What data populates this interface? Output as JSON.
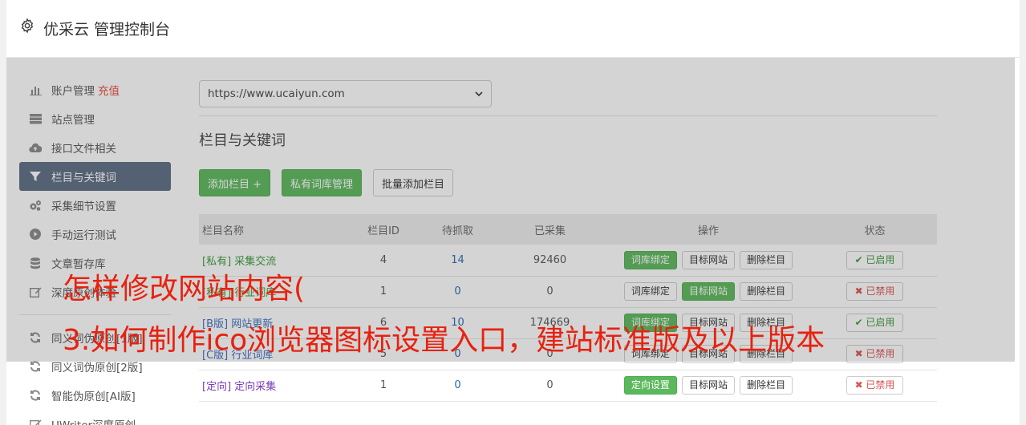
{
  "header": {
    "title": "优采云 管理控制台",
    "icon": "gear-icon"
  },
  "sidebar": {
    "items": [
      {
        "label": "账户管理",
        "extra": "充值",
        "icon": "bar-chart-icon",
        "active": false
      },
      {
        "label": "站点管理",
        "icon": "server-icon",
        "active": false
      },
      {
        "label": "接口文件相关",
        "icon": "cloud-upload-icon",
        "active": false
      },
      {
        "label": "栏目与关键词",
        "icon": "filter-icon",
        "active": true
      },
      {
        "label": "采集细节设置",
        "icon": "cogs-icon",
        "active": false
      },
      {
        "label": "手动运行测试",
        "icon": "play-circle-icon",
        "active": false
      },
      {
        "label": "文章暂存库",
        "icon": "database-icon",
        "active": false
      },
      {
        "label": "深度原创体验",
        "icon": "edit-icon",
        "active": false
      }
    ],
    "items2": [
      {
        "label": "同义词伪原创[1版]",
        "icon": "refresh-icon"
      },
      {
        "label": "同义词伪原创[2版]",
        "icon": "refresh-icon"
      },
      {
        "label": "智能伪原创[AI版]",
        "icon": "refresh-icon"
      },
      {
        "label": "UWriter深度原创",
        "icon": "edit-icon"
      }
    ]
  },
  "main": {
    "site_select": "https://www.ucaiyun.com",
    "section_title": "栏目与关键词",
    "buttons": {
      "add": "添加栏目 +",
      "private_lib": "私有词库管理",
      "batch_add": "批量添加栏目"
    },
    "table": {
      "headers": [
        "栏目名称",
        "栏目ID",
        "待抓取",
        "已采集",
        "操作",
        "状态"
      ],
      "rows": [
        {
          "tag": "[私有]",
          "name": "采集交流",
          "tag_type": "private",
          "id": "4",
          "pending": "14",
          "collected": "92460",
          "op1": "词库绑定",
          "op1_green": true,
          "op2": "目标网站",
          "op2_green": false,
          "op3": "删除栏目",
          "state": "✔ 已启用",
          "state_on": true
        },
        {
          "tag": "[私有]",
          "name": "行业词库",
          "tag_type": "private",
          "id": "1",
          "pending": "0",
          "collected": "0",
          "op1": "词库绑定",
          "op1_green": false,
          "op2": "目标网站",
          "op2_green": true,
          "op3": "删除栏目",
          "state": "✖ 已禁用",
          "state_on": false
        },
        {
          "tag": "[B版]",
          "name": "网站更新",
          "tag_type": "b",
          "id": "6",
          "pending": "10",
          "collected": "174669",
          "op1": "词库绑定",
          "op1_green": true,
          "op2": "目标网站",
          "op2_green": false,
          "op3": "删除栏目",
          "state": "✔ 已启用",
          "state_on": true
        },
        {
          "tag": "[C版]",
          "name": "行业词库",
          "tag_type": "b",
          "id": "5",
          "pending": "0",
          "collected": "0",
          "op1": "词库绑定",
          "op1_green": false,
          "op2": "目标网站",
          "op2_green": false,
          "op3": "删除栏目",
          "state": "✖ 已禁用",
          "state_on": false
        },
        {
          "tag": "[定向]",
          "name": "定向采集",
          "tag_type": "dir",
          "id": "1",
          "pending": "0",
          "collected": "0",
          "op1": "定向设置",
          "op1_green": true,
          "op2": "目标网站",
          "op2_green": false,
          "op3": "删除栏目",
          "state": "✖ 已禁用",
          "state_on": false
        }
      ]
    }
  },
  "watermark": {
    "line1": "怎样修改网站内容(",
    "line2": "3.如何制作ico浏览器图标设置入口，建站标准版及以上版本"
  }
}
